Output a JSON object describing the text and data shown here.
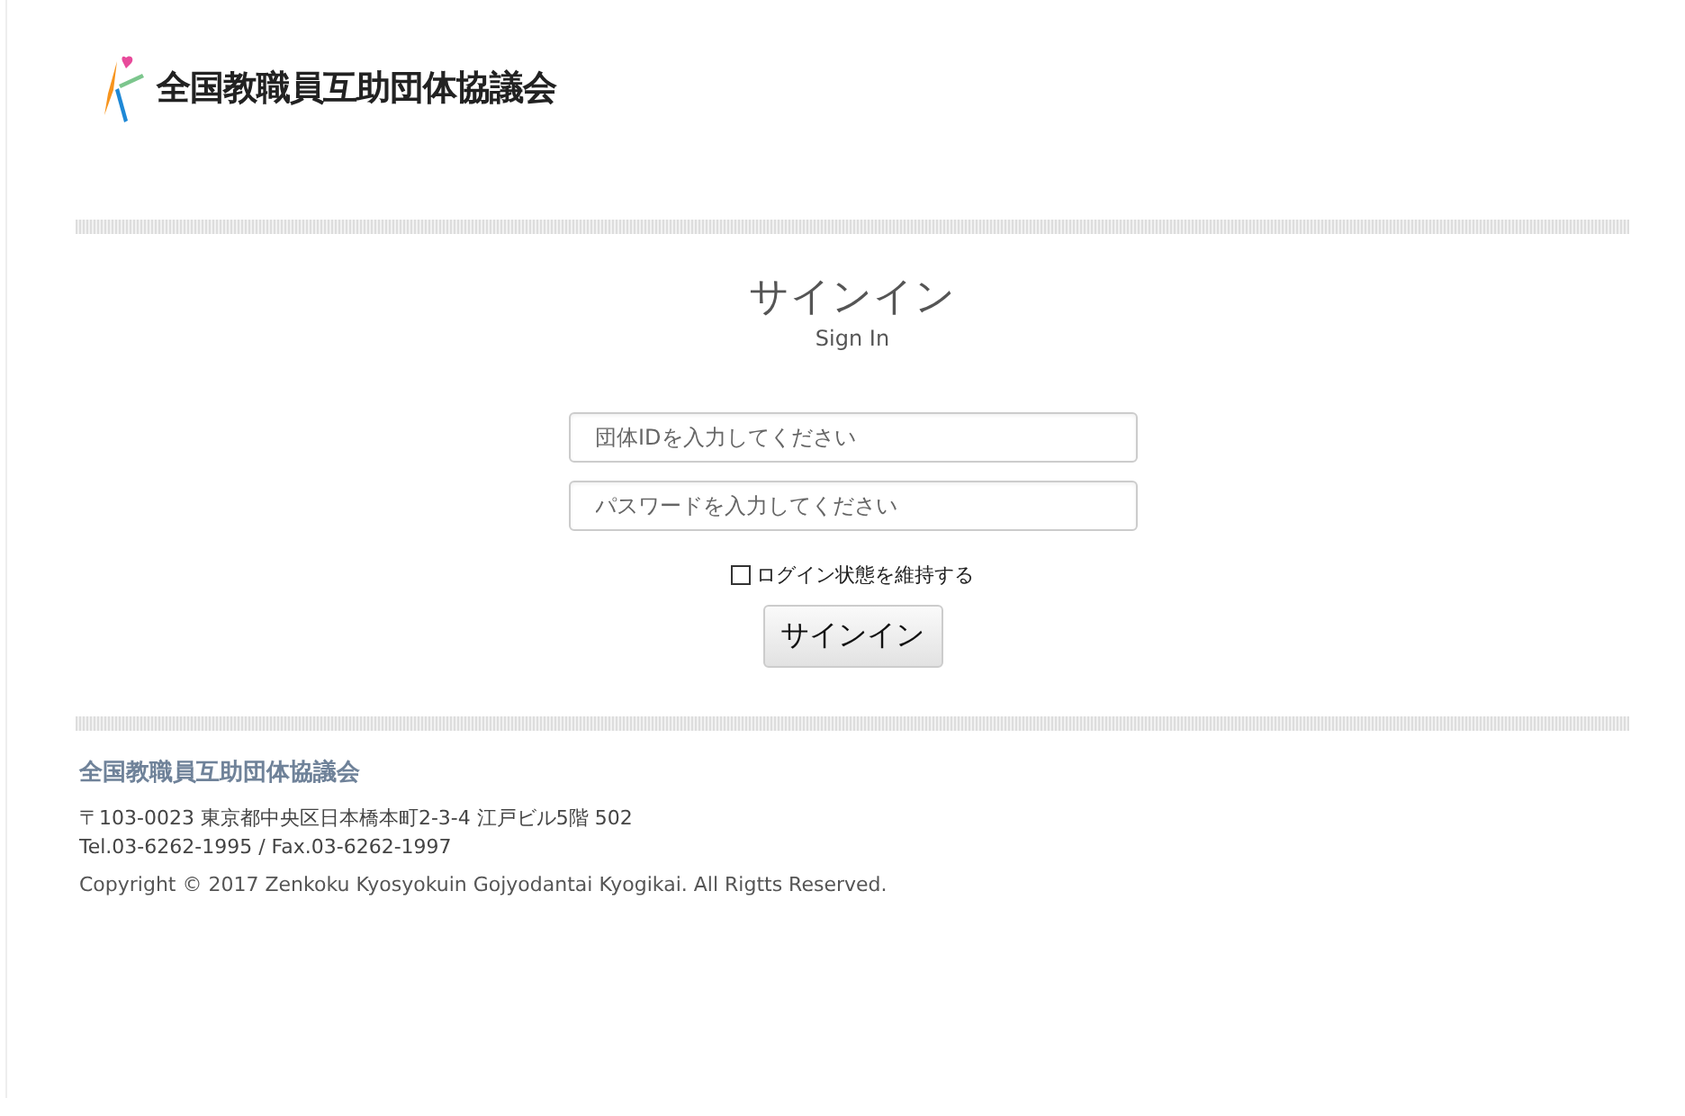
{
  "header": {
    "org_name": "全国教職員互助団体協議会"
  },
  "signin": {
    "title": "サインイン",
    "subtitle": "Sign In",
    "fields": [
      {
        "placeholder": "団体IDを入力してください"
      },
      {
        "placeholder": "パスワードを入力してください"
      }
    ],
    "remember": {
      "label": "ログイン状態を維持する",
      "checked": false
    },
    "button": "サインイン"
  },
  "footer": {
    "org_name": "全国教職員互助団体協議会",
    "address": "〒103-0023 東京都中央区日本橋本町2-3-4 江戸ビル5階 502",
    "contact": "Tel.03-6262-1995 / Fax.03-6262-1997",
    "copyright": "Copyright © 2017 Zenkoku Kyosyokuin Gojyodantai Kyogikai. All Rigtts Reserved."
  }
}
